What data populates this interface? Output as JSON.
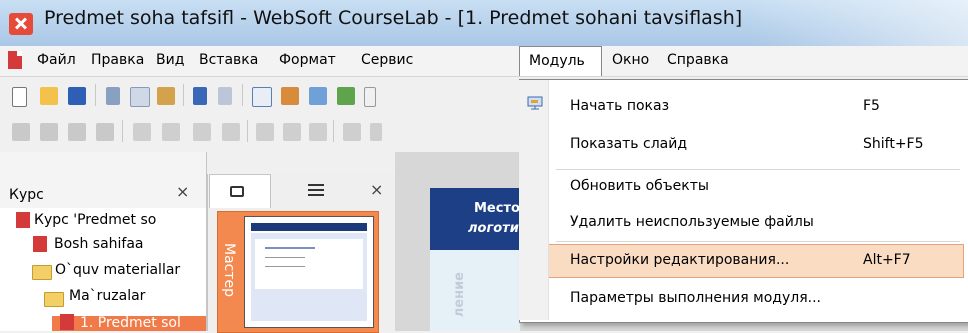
{
  "window": {
    "title": "Predmet soha tafsifl - WebSoft CourseLab - [1. Predmet sohani tavsiflash]"
  },
  "menubar": {
    "items": [
      "Файл",
      "Правка",
      "Вид",
      "Вставка",
      "Формат",
      "Сервис",
      "Модуль",
      "Окно",
      "Справка"
    ]
  },
  "module_menu": {
    "items": [
      {
        "label": "Начать показ",
        "shortcut": "F5"
      },
      {
        "label": "Показать слайд",
        "shortcut": "Shift+F5"
      },
      {
        "label": "Обновить объекты",
        "shortcut": ""
      },
      {
        "label": "Удалить неиспользуемые файлы",
        "shortcut": ""
      },
      {
        "label": "Настройки  редактирования...",
        "shortcut": "Alt+F7"
      },
      {
        "label": "Параметры выполнения модуля...",
        "shortcut": ""
      }
    ],
    "highlighted_index": 4
  },
  "left_panel": {
    "title": "Курс",
    "close": "×",
    "tree": [
      "Курс 'Predmet so",
      "Bosh sahifaa",
      "O`quv materiallar",
      "Ma`ruzalar",
      "1. Predmet sol"
    ]
  },
  "mid_panel": {
    "close": "×",
    "master_label": "Мастер"
  },
  "slide_preview": {
    "line1": "Место",
    "line2": "логоти",
    "vertical": "ление"
  },
  "colors": {
    "accent": "#f3894f",
    "highlight": "#f9dcc2",
    "navy": "#1c3f85"
  }
}
